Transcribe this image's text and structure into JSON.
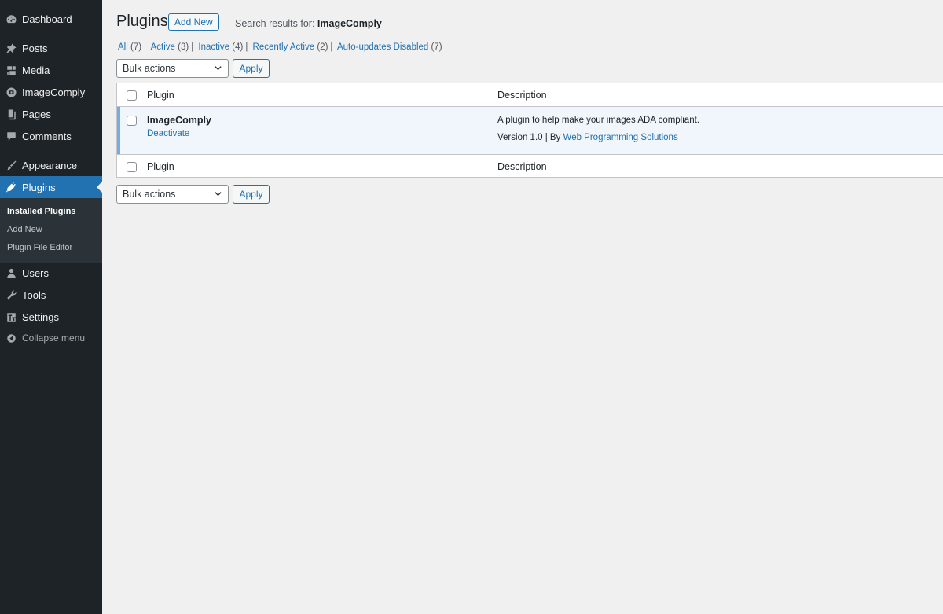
{
  "sidebar": {
    "items": [
      {
        "label": "Dashboard",
        "icon": "dashboard-icon"
      },
      {
        "label": "Posts",
        "icon": "pin-icon"
      },
      {
        "label": "Media",
        "icon": "media-icon"
      },
      {
        "label": "ImageComply",
        "icon": "imagecomply-icon"
      },
      {
        "label": "Pages",
        "icon": "pages-icon"
      },
      {
        "label": "Comments",
        "icon": "comment-icon"
      },
      {
        "label": "Appearance",
        "icon": "brush-icon"
      },
      {
        "label": "Plugins",
        "icon": "plugin-icon"
      },
      {
        "label": "Users",
        "icon": "user-icon"
      },
      {
        "label": "Tools",
        "icon": "wrench-icon"
      },
      {
        "label": "Settings",
        "icon": "settings-icon"
      }
    ],
    "submenu": [
      "Installed Plugins",
      "Add New",
      "Plugin File Editor"
    ],
    "collapse_label": "Collapse menu"
  },
  "header": {
    "title": "Plugins",
    "add_new": "Add New",
    "search_prefix": "Search results for: ",
    "search_term": "ImageComply"
  },
  "filters": [
    {
      "label": "All",
      "count": "(7)"
    },
    {
      "label": "Active",
      "count": "(3)"
    },
    {
      "label": "Inactive",
      "count": "(4)"
    },
    {
      "label": "Recently Active",
      "count": "(2)"
    },
    {
      "label": "Auto-updates Disabled",
      "count": "(7)"
    }
  ],
  "bulk": {
    "selected": "Bulk actions",
    "apply": "Apply"
  },
  "table": {
    "columns": [
      "Plugin",
      "Description"
    ],
    "plugin": {
      "name": "ImageComply",
      "action": "Deactivate",
      "description": "A plugin to help make your images ADA compliant.",
      "version_text": "Version 1.0 | By ",
      "author": "Web Programming Solutions"
    }
  },
  "colors": {
    "accent": "#2271b1",
    "sidebar_bg": "#1d2327",
    "active_row": "#f0f6fc",
    "active_border": "#72aee6"
  }
}
